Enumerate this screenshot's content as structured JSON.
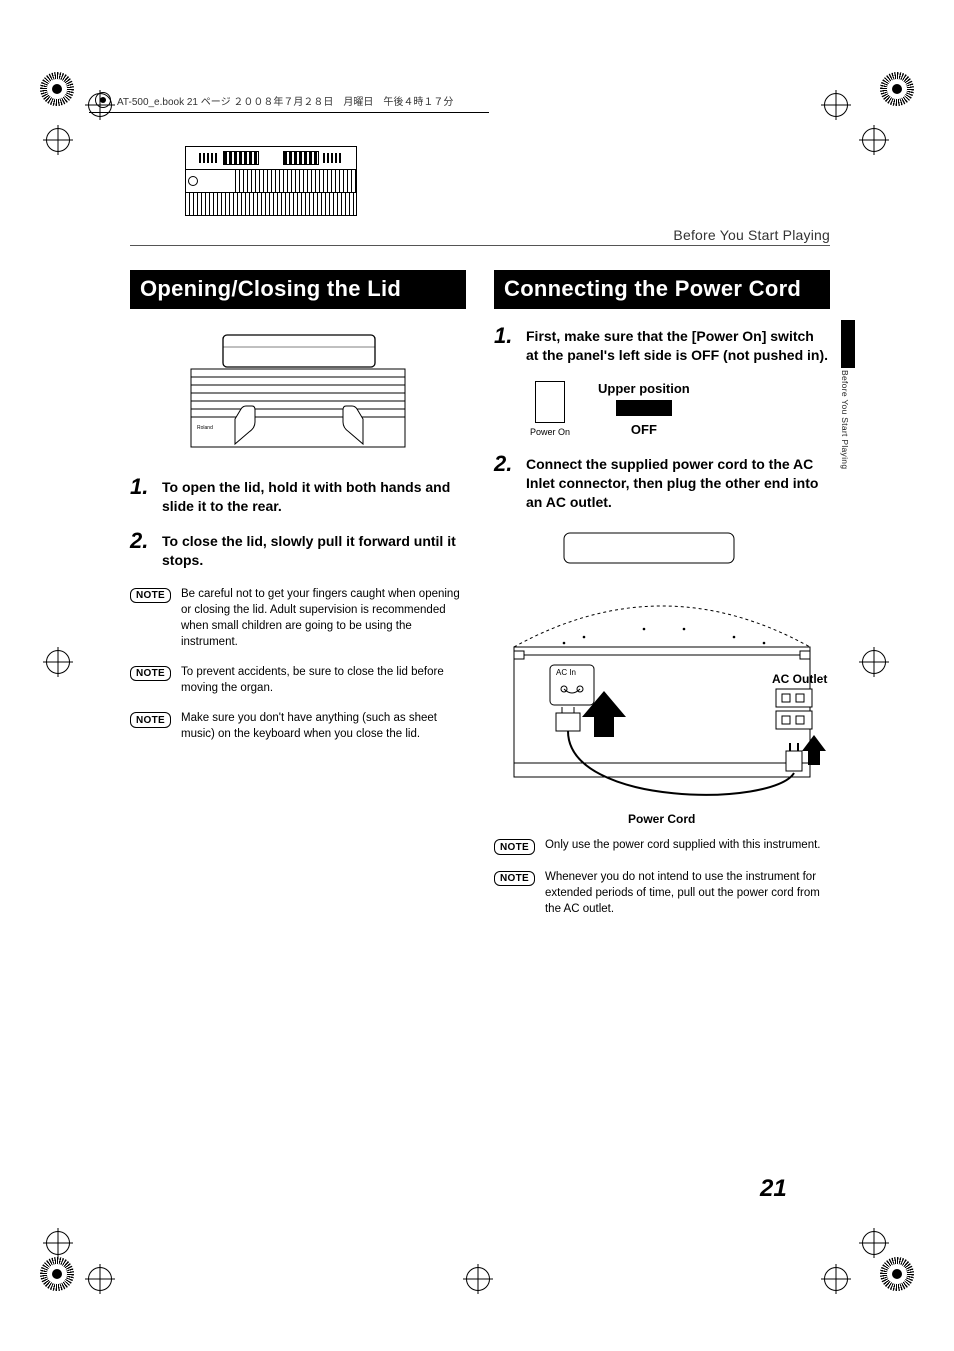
{
  "meta": {
    "framemaker_line": "AT-500_e.book  21 ページ  ２００８年７月２８日　月曜日　午後４時１７分"
  },
  "running_head": "Before You Start Playing",
  "side_label": "Before You Start Playing",
  "page_number": "21",
  "left": {
    "heading": "Opening/Closing the Lid",
    "steps": [
      "To open the lid, hold it with both hands and slide it to the rear.",
      "To close the lid, slowly pull it forward until it stops."
    ],
    "notes": [
      "Be careful not to get your fingers caught when opening or closing the lid. Adult supervision is recommended when small children are going to be using the instrument.",
      "To prevent accidents, be sure to close the lid before moving the organ.",
      "Make sure you don't have anything (such as sheet music) on the keyboard when you close the lid."
    ],
    "note_label": "NOTE"
  },
  "right": {
    "heading": "Connecting the Power Cord",
    "steps": [
      "First, make sure that the [Power On] switch at the panel's left side is OFF (not pushed in).",
      "Connect the supplied power cord to the AC Inlet connector, then plug the other end into an AC outlet."
    ],
    "switch": {
      "left_caption": "Power On",
      "right_top": "Upper position",
      "right_bottom": "OFF"
    },
    "diagram": {
      "ac_in": "AC In",
      "ac_outlet": "AC Outlet",
      "power_cord": "Power Cord"
    },
    "notes": [
      "Only use the power cord supplied with this instrument.",
      "Whenever you do not intend to use the instrument for extended periods of time, pull out the power cord from the AC outlet."
    ],
    "note_label": "NOTE"
  }
}
